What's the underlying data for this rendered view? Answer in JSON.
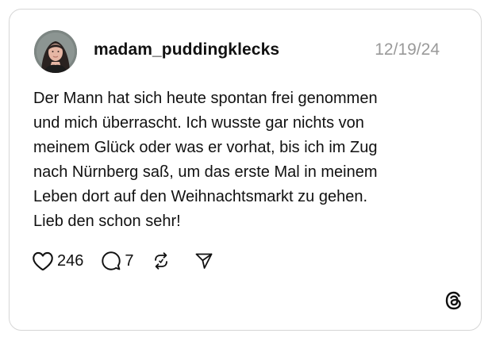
{
  "post": {
    "username": "madam_puddingklecks",
    "date": "12/19/24",
    "text_lines": [
      "Der Mann hat sich heute spontan frei genommen",
      "und mich überrascht. Ich wusste gar nichts von",
      "meinem Glück oder was er vorhat, bis ich im Zug",
      "nach Nürnberg saß, um das erste Mal in meinem",
      "Leben dort auf den Weihnachtsmarkt zu gehen.",
      "Lieb den schon sehr!"
    ]
  },
  "actions": {
    "likes": "246",
    "replies": "7"
  },
  "icons": {
    "like": "heart-icon",
    "reply": "comment-bubble-icon",
    "repost": "repost-icon",
    "share": "send-icon",
    "brand": "threads-logo-icon"
  },
  "colors": {
    "text": "#111111",
    "date": "#9a9a9a",
    "border": "#d6d6d6"
  }
}
